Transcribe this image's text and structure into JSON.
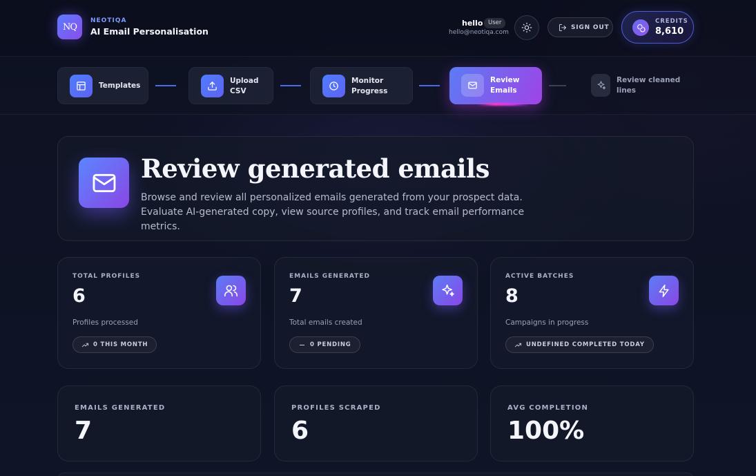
{
  "header": {
    "brand_small": "NEOTIQA",
    "brand_title": "AI Email Personalisation",
    "logo_text": "NQ",
    "user_name": "hello",
    "user_role": "User",
    "user_email": "hello@neotiqa.com",
    "signout_label": "SIGN OUT",
    "credits_label": "CREDITS",
    "credits_value": "8,610"
  },
  "steps": [
    {
      "label": "Templates",
      "icon": "layout-icon",
      "state": "done"
    },
    {
      "label": "Upload\nCSV",
      "icon": "upload-icon",
      "state": "done"
    },
    {
      "label": "Monitor\nProgress",
      "icon": "clock-icon",
      "state": "done"
    },
    {
      "label": "Review\nEmails",
      "icon": "mail-icon",
      "state": "active"
    },
    {
      "label": "Review cleaned\nlines",
      "icon": "sparkles-icon",
      "state": "pending"
    }
  ],
  "hero": {
    "title": "Review generated emails",
    "description": "Browse and review all personalized emails generated from your prospect data. Evaluate AI-generated copy, view source profiles, and track email performance metrics."
  },
  "stats": [
    {
      "label": "TOTAL PROFILES",
      "value": "6",
      "caption": "Profiles processed",
      "badge": "0 THIS MONTH",
      "icon": "users-icon",
      "badge_icon": "trend-up-icon"
    },
    {
      "label": "EMAILS GENERATED",
      "value": "7",
      "caption": "Total emails created",
      "badge": "0 PENDING",
      "icon": "sparkles-icon",
      "badge_icon": "minus-icon"
    },
    {
      "label": "ACTIVE BATCHES",
      "value": "8",
      "caption": "Campaigns in progress",
      "badge": "UNDEFINED COMPLETED TODAY",
      "icon": "bolt-icon",
      "badge_icon": "trend-up-icon"
    }
  ],
  "summary": [
    {
      "label": "EMAILS GENERATED",
      "value": "7"
    },
    {
      "label": "PROFILES SCRAPED",
      "value": "6"
    },
    {
      "label": "AVG COMPLETION",
      "value": "100%"
    }
  ],
  "colors": {
    "accent_blue": "#5b7cf4",
    "accent_purple": "#9f43e6",
    "background": "#0c1020"
  }
}
